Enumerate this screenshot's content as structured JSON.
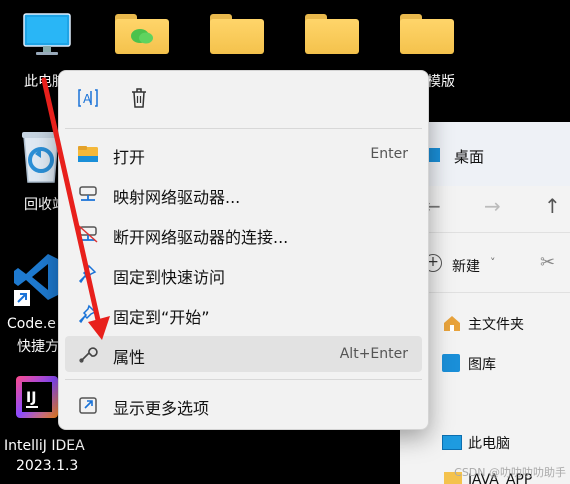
{
  "desktop": {
    "icons": [
      {
        "label": "此电脑",
        "icon": "monitor-icon"
      },
      {
        "label": "回收站",
        "icon": "recycle-bin-icon"
      },
      {
        "label": "Code.exe 快捷方式",
        "line1": "Code.e",
        "line2": "快捷方",
        "icon": "vscode-icon"
      },
      {
        "label": "IntelliJ IDEA 2023.1.3",
        "line1": "IntelliJ IDEA",
        "line2": "2023.1.3",
        "icon": "intellij-icon"
      }
    ],
    "partial_label": "模版",
    "visible_labels": {
      "this_pc": "此电脑",
      "recycle": "回收站"
    }
  },
  "explorer": {
    "title": "桌面",
    "new_label": "新建",
    "sidebar": [
      "主文件夹",
      "图库",
      "此电脑",
      "JAVA_APP"
    ]
  },
  "context_menu": {
    "top_icons": [
      "rename-icon",
      "delete-icon"
    ],
    "items": [
      {
        "label": "打开",
        "shortcut": "Enter",
        "icon": "folder-open-icon"
      },
      {
        "label": "映射网络驱动器...",
        "shortcut": "",
        "icon": "map-network-drive-icon"
      },
      {
        "label": "断开网络驱动器的连接...",
        "shortcut": "",
        "icon": "disconnect-network-drive-icon"
      },
      {
        "label": "固定到快速访问",
        "shortcut": "",
        "icon": "pin-icon"
      },
      {
        "label": "固定到“开始”",
        "shortcut": "",
        "icon": "pin-start-icon"
      },
      {
        "label": "属性",
        "shortcut": "Alt+Enter",
        "icon": "wrench-icon",
        "highlighted": true
      },
      {
        "label": "显示更多选项",
        "shortcut": "",
        "icon": "more-options-icon"
      }
    ]
  },
  "watermark": "CSDN @叻叻叻叻助手",
  "colors": {
    "annotation_arrow": "#e8201c",
    "menu_bg": "#f2f2f2",
    "accent_blue": "#1a73d8"
  }
}
